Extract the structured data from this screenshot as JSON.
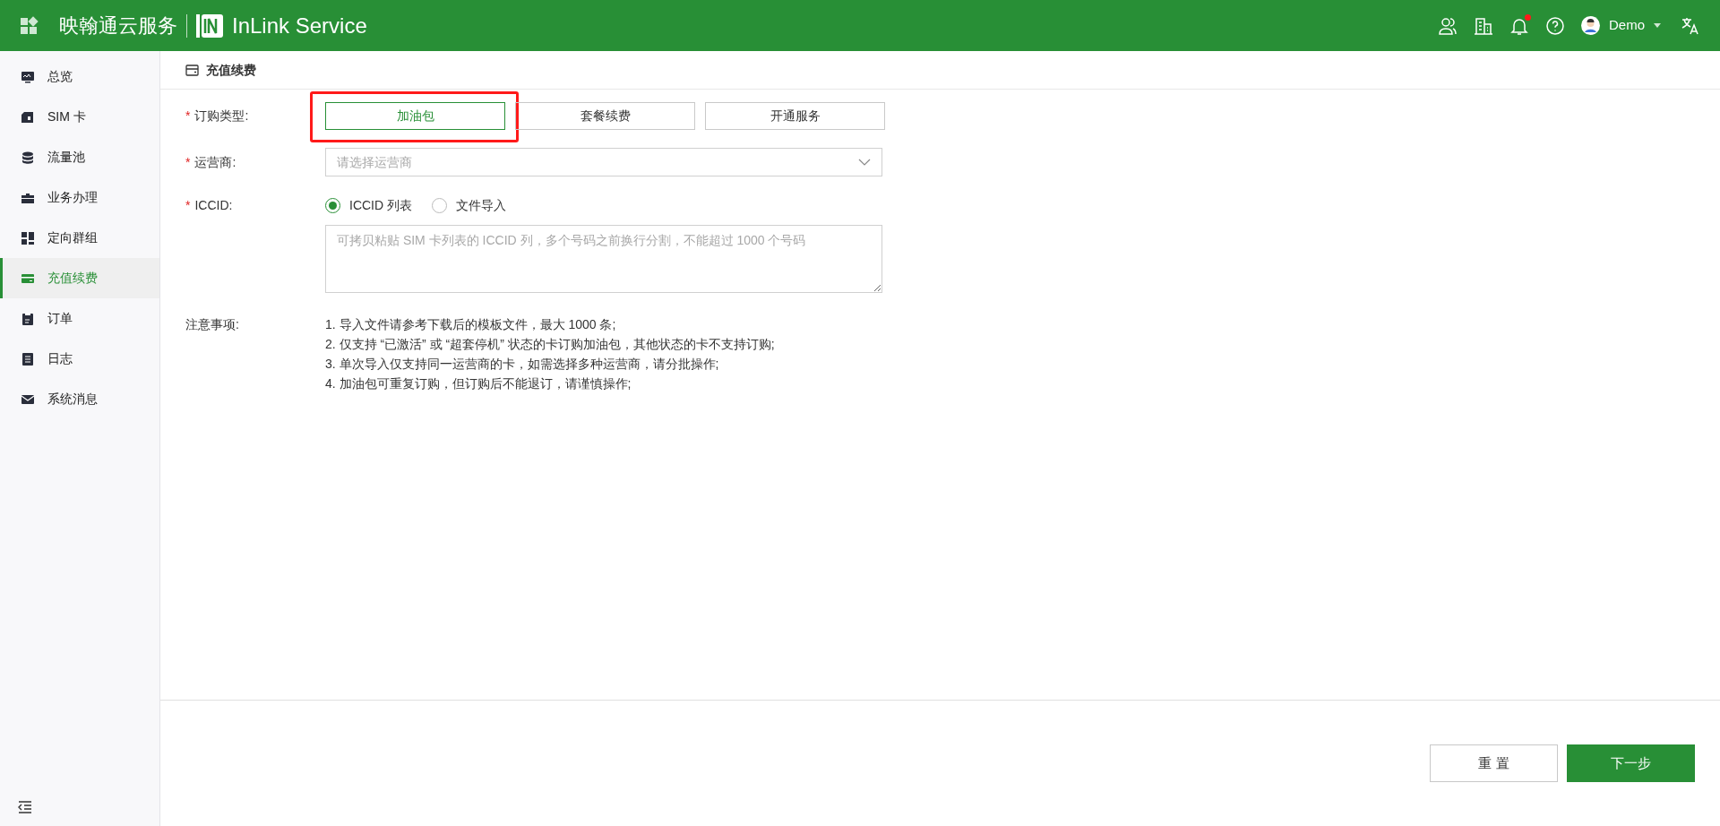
{
  "header": {
    "brand_cn": "映翰通云服务",
    "brand_en": "InLink Service",
    "user": "Demo",
    "notification_unread": true
  },
  "sidebar": {
    "items": [
      {
        "label": "总览",
        "selected": false
      },
      {
        "label": "SIM 卡",
        "selected": false
      },
      {
        "label": "流量池",
        "selected": false
      },
      {
        "label": "业务办理",
        "selected": false
      },
      {
        "label": "定向群组",
        "selected": false
      },
      {
        "label": "充值续费",
        "selected": true
      },
      {
        "label": "订单",
        "selected": false
      },
      {
        "label": "日志",
        "selected": false
      },
      {
        "label": "系统消息",
        "selected": false
      }
    ]
  },
  "page": {
    "title": "充值续费"
  },
  "form": {
    "order_type": {
      "label": "订购类型:",
      "required_mark": "*",
      "options": [
        {
          "label": "加油包",
          "selected": true,
          "highlighted": true
        },
        {
          "label": "套餐续费",
          "selected": false,
          "highlighted": false
        },
        {
          "label": "开通服务",
          "selected": false,
          "highlighted": false
        }
      ]
    },
    "carrier": {
      "label": "运营商:",
      "required_mark": "*",
      "placeholder": "请选择运营商"
    },
    "iccid": {
      "label": "ICCID:",
      "required_mark": "*",
      "modes": [
        {
          "label": "ICCID 列表",
          "selected": true
        },
        {
          "label": "文件导入",
          "selected": false
        }
      ],
      "placeholder": "可拷贝粘贴 SIM 卡列表的 ICCID 列，多个号码之前换行分割，不能超过 1000 个号码"
    },
    "notes": {
      "label": "注意事项:",
      "lines": [
        "1. 导入文件请参考下载后的模板文件，最大 1000 条;",
        "2. 仅支持 “已激活” 或 “超套停机” 状态的卡订购加油包，其他状态的卡不支持订购;",
        "3. 单次导入仅支持同一运营商的卡，如需选择多种运营商，请分批操作;",
        "4. 加油包可重复订购，但订购后不能退订，请谨慎操作;"
      ]
    }
  },
  "actions": {
    "reset": "重 置",
    "next": "下一步"
  }
}
